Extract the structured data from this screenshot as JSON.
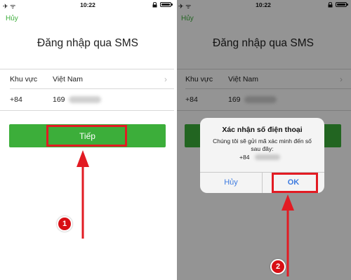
{
  "left_screen": {
    "status": {
      "airplane": "✈",
      "wifi": "ᯤ",
      "time": "10:22",
      "lock_icon": "lock-icon"
    },
    "cancel_label": "Hủy",
    "title": "Đăng nhập qua SMS",
    "region_label": "Khu vực",
    "region_value": "Việt Nam",
    "country_code": "+84",
    "phone_prefix": "169",
    "next_label": "Tiếp",
    "step": "1"
  },
  "right_screen": {
    "status": {
      "airplane": "✈",
      "wifi": "ᯤ",
      "time": "10:22",
      "lock_icon": "lock-icon"
    },
    "cancel_label": "Hủy",
    "title": "Đăng nhập qua SMS",
    "region_label": "Khu vực",
    "region_value": "Việt Nam",
    "country_code": "+84",
    "phone_prefix": "169",
    "dialog": {
      "title": "Xác nhận số điện thoại",
      "message": "Chúng tôi sẽ gửi mã xác minh đến số sau đây:",
      "code": "+84",
      "cancel_label": "Hủy",
      "ok_label": "OK"
    },
    "step": "2"
  },
  "colors": {
    "accent_green": "#3cae3a",
    "annotation_red": "#e21b23",
    "link_blue": "#3d7be0"
  }
}
